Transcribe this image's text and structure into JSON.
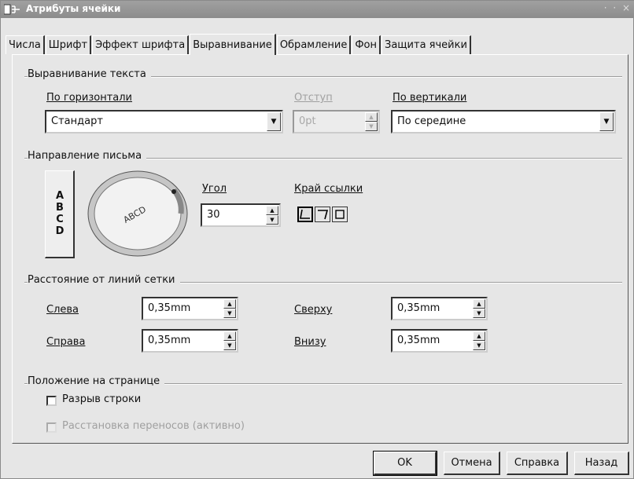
{
  "window": {
    "title": "Атрибуты ячейки",
    "controls": "· · ×"
  },
  "tabs": [
    {
      "label": "Числа"
    },
    {
      "label": "Шрифт"
    },
    {
      "label": "Эффект шрифта"
    },
    {
      "label": "Выравнивание",
      "active": true
    },
    {
      "label": "Обрамление"
    },
    {
      "label": "Фон"
    },
    {
      "label": "Защита ячейки"
    }
  ],
  "text_alignment": {
    "title": "Выравнивание текста",
    "horizontal": {
      "label": "По горизонтали",
      "value": "Стандарт"
    },
    "indent": {
      "label": "Отступ",
      "value": "0pt"
    },
    "vertical": {
      "label": "По вертикали",
      "value": "По середине"
    }
  },
  "writing_direction": {
    "title": "Направление письма",
    "vertical_text": "ABCD",
    "dial_text": "ABCD",
    "angle": {
      "label": "Угол",
      "value": "30"
    },
    "reference_edge": {
      "label": "Край ссылки"
    }
  },
  "grid_spacing": {
    "title": "Расстояние от линий сетки",
    "left": {
      "label": "Слева",
      "value": "0,35mm"
    },
    "right": {
      "label": "Справа",
      "value": "0,35mm"
    },
    "top": {
      "label": "Сверху",
      "value": "0,35mm"
    },
    "bottom": {
      "label": "Внизу",
      "value": "0,35mm"
    }
  },
  "page_position": {
    "title": "Положение на странице",
    "line_break": {
      "label": "Разрыв строки",
      "checked": false
    },
    "hyphenation": {
      "label": "Расстановка переносов (активно)",
      "checked": false,
      "disabled": true
    }
  },
  "buttons": {
    "ok": "OK",
    "cancel": "Отмена",
    "help": "Справка",
    "back": "Назад"
  }
}
